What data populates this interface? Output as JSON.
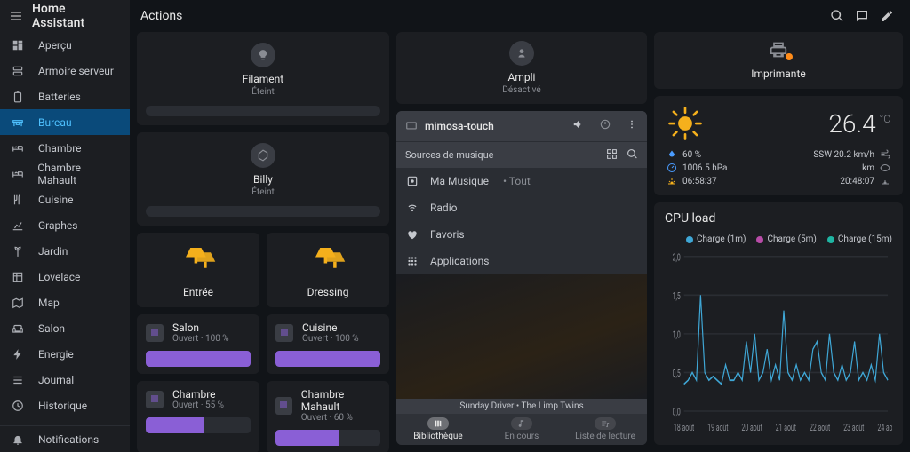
{
  "app_title": "Home Assistant",
  "sidebar": {
    "items": [
      {
        "label": "Aperçu",
        "icon": "dashboard"
      },
      {
        "label": "Armoire serveur",
        "icon": "server"
      },
      {
        "label": "Batteries",
        "icon": "battery"
      },
      {
        "label": "Bureau",
        "icon": "desk",
        "active": true
      },
      {
        "label": "Chambre",
        "icon": "bed"
      },
      {
        "label": "Chambre Mahault",
        "icon": "bed"
      },
      {
        "label": "Cuisine",
        "icon": "kitchen"
      },
      {
        "label": "Graphes",
        "icon": "chart"
      },
      {
        "label": "Jardin",
        "icon": "garden"
      },
      {
        "label": "Lovelace",
        "icon": "window"
      },
      {
        "label": "Map",
        "icon": "map"
      },
      {
        "label": "Salon",
        "icon": "sofa"
      },
      {
        "label": "Energie",
        "icon": "bolt"
      },
      {
        "label": "Journal",
        "icon": "list"
      },
      {
        "label": "Historique",
        "icon": "history"
      }
    ],
    "footer": {
      "label": "Notifications",
      "icon": "bell"
    }
  },
  "page_title": "Actions",
  "lights": {
    "filament": {
      "name": "Filament",
      "state": "Éteint"
    },
    "billy": {
      "name": "Billy",
      "state": "Éteint"
    }
  },
  "bells": {
    "entree": "Entrée",
    "dressing": "Dressing"
  },
  "covers": [
    {
      "name": "Salon",
      "state": "Ouvert",
      "pct": "100 %",
      "fill": 100
    },
    {
      "name": "Cuisine",
      "state": "Ouvert",
      "pct": "100 %",
      "fill": 100
    },
    {
      "name": "Chambre",
      "state": "Ouvert",
      "pct": "55 %",
      "fill": 55
    },
    {
      "name": "Chambre Mahault",
      "state": "Ouvert",
      "pct": "60 %",
      "fill": 60
    }
  ],
  "ampli": {
    "name": "Ampli",
    "state": "Désactivé"
  },
  "music": {
    "device": "mimosa-touch",
    "sources_label": "Sources de musique",
    "items": [
      {
        "label": "Ma Musique",
        "sub": "Tout",
        "icon": "library"
      },
      {
        "label": "Radio",
        "icon": "radio"
      },
      {
        "label": "Favoris",
        "icon": "heart"
      },
      {
        "label": "Applications",
        "icon": "apps"
      }
    ],
    "now_playing": "Sunday Driver • The Limp Twins",
    "tabs": {
      "library": "Bibliothèque",
      "playing": "En cours",
      "playlist": "Liste de lecture"
    }
  },
  "printer": {
    "name": "Imprimante"
  },
  "weather": {
    "temp": "26.4",
    "unit": "°C",
    "humidity": "60 %",
    "wind": "SSW 20.2 km/h",
    "pressure": "1006.5 hPa",
    "distance": "km",
    "sun_time": "06:58:37",
    "clock": "20:48:07"
  },
  "cpu": {
    "title": "CPU load",
    "legend": [
      {
        "label": "Charge (1m)",
        "color": "#3fa7d6"
      },
      {
        "label": "Charge (5m)",
        "color": "#b84ca8"
      },
      {
        "label": "Charge (15m)",
        "color": "#1fb5a3"
      }
    ]
  },
  "chart_data": {
    "type": "line",
    "title": "CPU load",
    "ylabel": "",
    "ylim": [
      0,
      2.0
    ],
    "yticks": [
      0,
      0.5,
      1.0,
      1.5,
      2.0
    ],
    "categories": [
      "18 août",
      "19 août",
      "20 août",
      "21 août",
      "22 août",
      "23 août",
      "24 août"
    ],
    "series": [
      {
        "name": "Charge (1m)",
        "color": "#3fa7d6",
        "values": [
          0.35,
          0.4,
          0.5,
          0.4,
          1.5,
          0.5,
          0.4,
          0.45,
          0.4,
          0.35,
          0.6,
          0.4,
          0.4,
          0.5,
          0.4,
          0.9,
          0.5,
          1.0,
          0.4,
          0.5,
          0.8,
          0.4,
          0.6,
          0.4,
          1.3,
          0.5,
          0.4,
          0.6,
          0.4,
          0.5,
          0.4,
          0.8,
          0.9,
          0.5,
          0.4,
          1.0,
          0.5,
          0.4,
          0.6,
          0.4,
          0.5,
          0.9,
          0.4,
          0.5,
          0.4,
          0.6,
          0.4,
          1.0,
          0.5,
          0.4
        ]
      },
      {
        "name": "Charge (5m)",
        "color": "#b84ca8",
        "values": []
      },
      {
        "name": "Charge (15m)",
        "color": "#1fb5a3",
        "values": []
      }
    ]
  }
}
